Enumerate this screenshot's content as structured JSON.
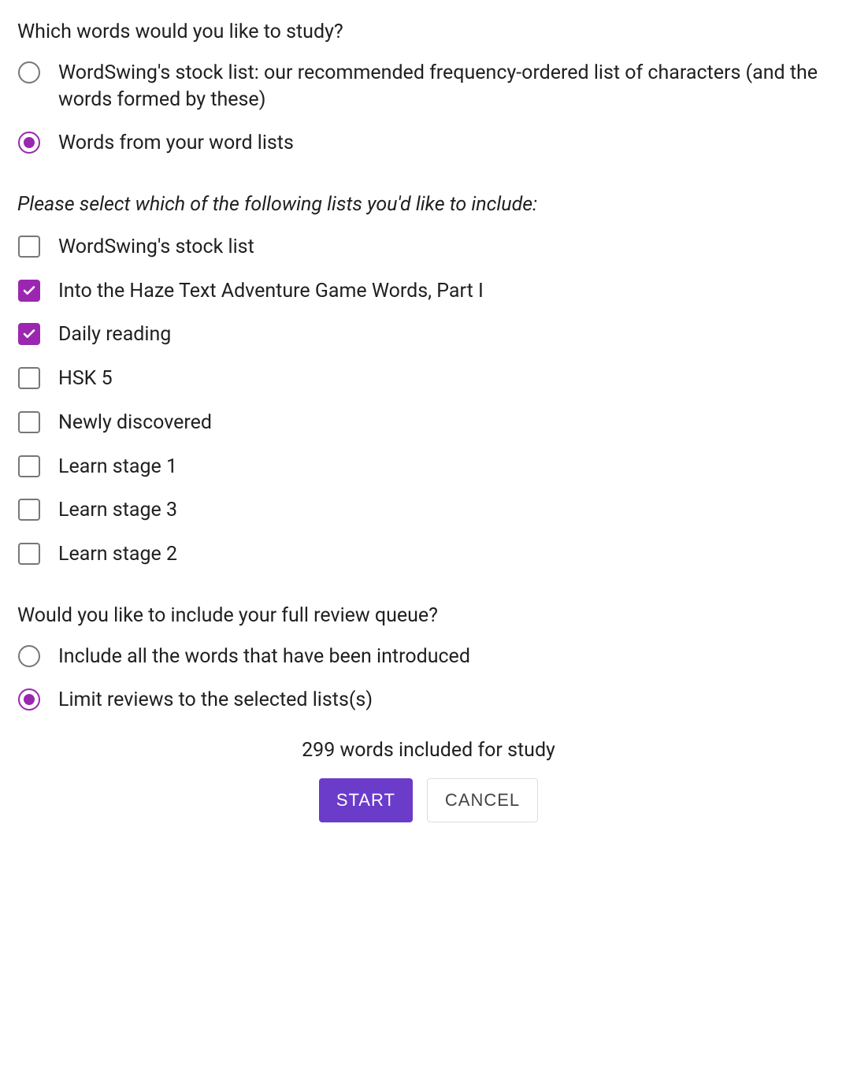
{
  "study": {
    "heading": "Which words would you like to study?",
    "options": [
      {
        "label": "WordSwing's stock list: our recommended frequency-ordered list of characters (and the words formed by these)",
        "selected": false
      },
      {
        "label": "Words from your word lists",
        "selected": true
      }
    ]
  },
  "lists": {
    "subheading": "Please select which of the following lists you'd like to include:",
    "items": [
      {
        "label": "WordSwing's stock list",
        "checked": false
      },
      {
        "label": "Into the Haze Text Adventure Game Words, Part I",
        "checked": true
      },
      {
        "label": "Daily reading",
        "checked": true
      },
      {
        "label": "HSK 5",
        "checked": false
      },
      {
        "label": "Newly discovered",
        "checked": false
      },
      {
        "label": "Learn stage 1",
        "checked": false
      },
      {
        "label": "Learn stage 3",
        "checked": false
      },
      {
        "label": "Learn stage 2",
        "checked": false
      }
    ]
  },
  "queue": {
    "heading": "Would you like to include your full review queue?",
    "options": [
      {
        "label": "Include all the words that have been introduced",
        "selected": false
      },
      {
        "label": "Limit reviews to the selected lists(s)",
        "selected": true
      }
    ]
  },
  "summary": "299 words included for study",
  "buttons": {
    "start": "START",
    "cancel": "CANCEL"
  }
}
